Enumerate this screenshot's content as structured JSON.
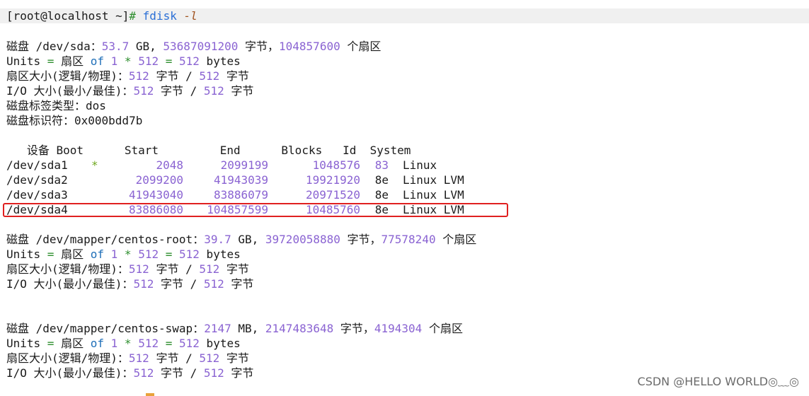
{
  "prompt": {
    "user_host": "[root@localhost ~]",
    "hash": "#",
    "command": "fdisk",
    "flag": "-l"
  },
  "disk_sda": {
    "pre": "磁盘 /dev/sda：",
    "size": "53.7",
    "unit": " GB, ",
    "bytes": "53687091200",
    "bytes_label": " 字节，",
    "sectors": "104857600",
    "sectors_label": " 个扇区",
    "units_pre": "Units ",
    "units_eq": "=",
    "units_mid1": " 扇区 ",
    "units_of": "of",
    "units_sp": " ",
    "units_1": "1",
    "units_star": "*",
    "units_512a": "512",
    "units_eq2": "=",
    "units_512b": "512",
    "units_bytes": " bytes",
    "sector_size_pre": "扇区大小(逻辑/物理)：",
    "sector_logical": "512",
    "sector_mid": " 字节 / ",
    "sector_physical": "512",
    "sector_post": " 字节",
    "io_pre": "I/O 大小(最小/最佳)：",
    "io_min": "512",
    "io_mid": " 字节 / ",
    "io_opt": "512",
    "io_post": " 字节",
    "label_type": "磁盘标签类型：dos",
    "identifier": "磁盘标识符：0x000bdd7b"
  },
  "partition_table": {
    "header": "   设备 Boot      Start         End      Blocks   Id  System",
    "rows": [
      {
        "device": "/dev/sda1",
        "boot": "*",
        "start": "2048",
        "end": "2099199",
        "blocks": "1048576",
        "id": "83",
        "system": "Linux"
      },
      {
        "device": "/dev/sda2",
        "boot": "",
        "start": "2099200",
        "end": "41943039",
        "blocks": "19921920",
        "id": "8e",
        "system": "Linux LVM"
      },
      {
        "device": "/dev/sda3",
        "boot": "",
        "start": "41943040",
        "end": "83886079",
        "blocks": "20971520",
        "id": "8e",
        "system": "Linux LVM"
      },
      {
        "device": "/dev/sda4",
        "boot": "",
        "start": "83886080",
        "end": "104857599",
        "blocks": "10485760",
        "id": "8e",
        "system": "Linux LVM"
      }
    ]
  },
  "disk_root": {
    "pre": "磁盘 /dev/mapper/centos-root：",
    "size": "39.7",
    "unit": " GB, ",
    "bytes": "39720058880",
    "bytes_label": " 字节，",
    "sectors": "77578240",
    "sectors_label": " 个扇区"
  },
  "disk_swap": {
    "pre": "磁盘 /dev/mapper/centos-swap：",
    "size": "2147",
    "unit": " MB, ",
    "bytes": "2147483648",
    "bytes_label": " 字节，",
    "sectors": "4194304",
    "sectors_label": " 个扇区"
  },
  "common": {
    "units_pre": "Units ",
    "units_eq": "=",
    "units_mid1": " 扇区 ",
    "units_of": "of",
    "units_1": "1",
    "units_star": "*",
    "units_512a": "512",
    "units_eq2": "=",
    "units_512b": "512",
    "units_bytes": " bytes",
    "sector_size_pre": "扇区大小(逻辑/物理)：",
    "sector_logical": "512",
    "sector_mid": " 字节 / ",
    "sector_physical": "512",
    "sector_post": " 字节",
    "io_pre": "I/O 大小(最小/最佳)：",
    "io_min": "512",
    "io_mid": " 字节 / ",
    "io_opt": "512",
    "io_post": " 字节"
  },
  "watermark": "CSDN @HELLO WORLD◎﹏◎",
  "colors": {
    "number": "#8a63d2",
    "highlight_border": "#e02020",
    "prompt_bg": "#f0f0f0"
  }
}
